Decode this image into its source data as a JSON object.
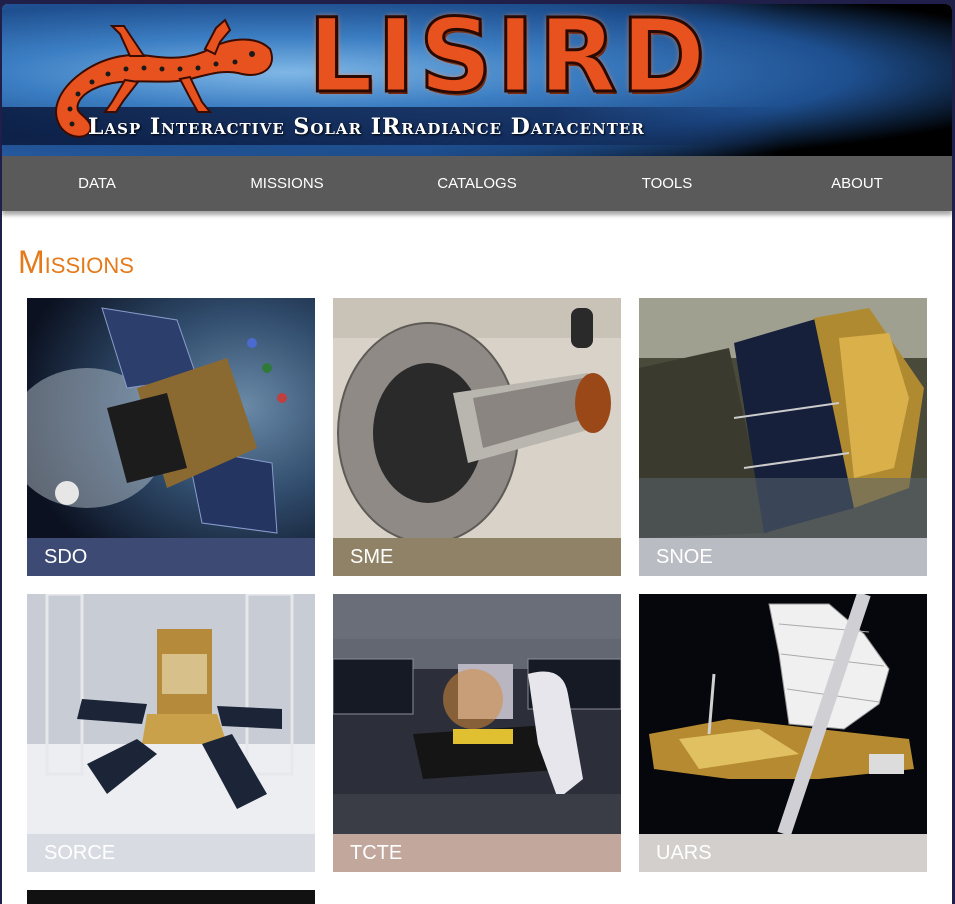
{
  "header": {
    "logo_text": "LISIRD",
    "logo_subtitle": "Lasp Interactive Solar IRradiance Datacenter"
  },
  "nav": {
    "items": [
      {
        "label": "DATA"
      },
      {
        "label": "MISSIONS"
      },
      {
        "label": "CATALOGS"
      },
      {
        "label": "TOOLS"
      },
      {
        "label": "ABOUT"
      }
    ]
  },
  "page": {
    "title": "Missions"
  },
  "missions": [
    {
      "name": "SDO",
      "caption_color": "#3d4a73"
    },
    {
      "name": "SME",
      "caption_color": "#8f8266"
    },
    {
      "name": "SNOE",
      "caption_color": "#b9bcc3"
    },
    {
      "name": "SORCE",
      "caption_color": "#d9dbe3"
    },
    {
      "name": "TCTE",
      "caption_color": "#c2a79c"
    },
    {
      "name": "UARS",
      "caption_color": "#d2cfcc"
    }
  ],
  "colors": {
    "accent": "#e47a19",
    "nav_bg": "#5a5a5a"
  }
}
